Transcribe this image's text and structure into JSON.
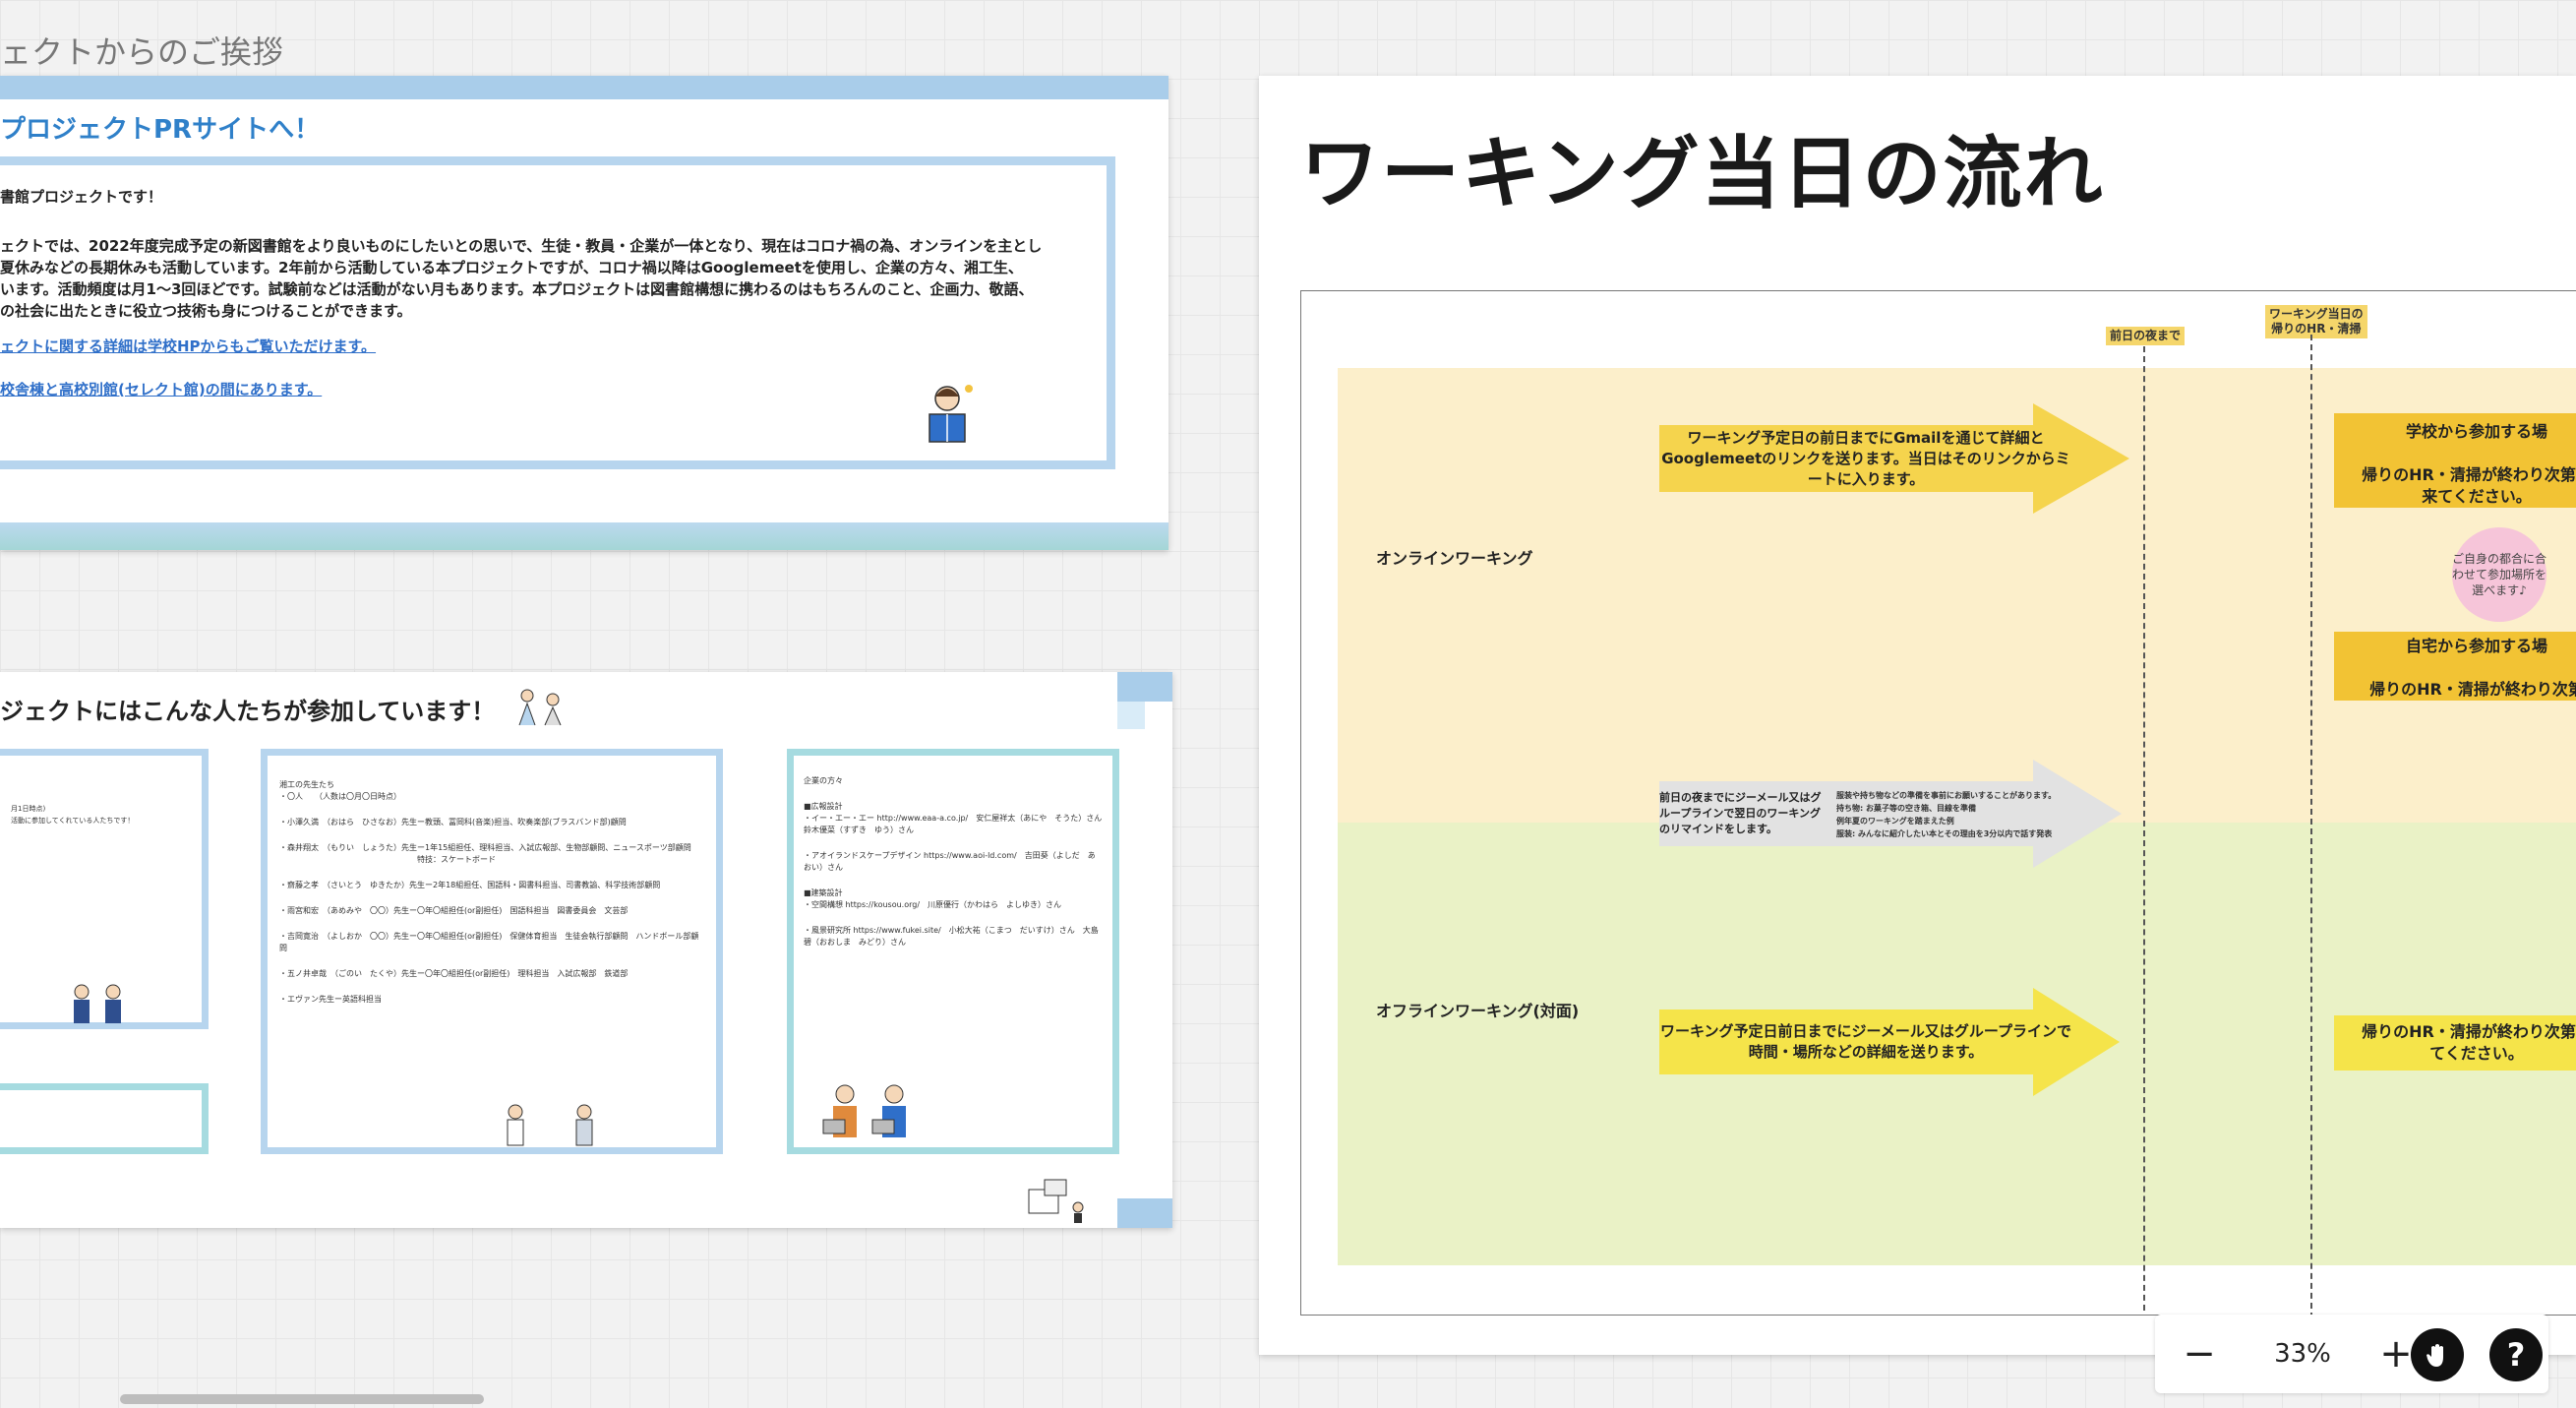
{
  "frame_label": "ェクトからのご挨拶",
  "slide1": {
    "title": "プロジェクトPRサイトへ！",
    "intro": "書館プロジェクトです！",
    "body_lines": [
      "ェクトでは、2022年度完成予定の新図書館をより良いものにしたいとの思いで、生徒・教員・企業が一体となり、現在はコロナ禍の為、オンラインを主とし",
      "夏休みなどの長期休みも活動しています。2年前から活動している本プロジェクトですが、コロナ禍以降はGooglemeetを使用し、企業の方々、湘工生、",
      "います。活動頻度は月1〜3回ほどです。試験前などは活動がない月もあります。本プロジェクトは図書館構想に携わるのはもちろんのこと、企画力、敬語、",
      "の社会に出たときに役立つ技術も身につけることができます。"
    ],
    "link1": "ェクトに関する詳細は学校HPからもご覧いただけます。",
    "link2": "校舎棟と高校別館(セレクト館)の間にあります。"
  },
  "slide2": {
    "title": "ジェクトにはこんな人たちが参加しています！",
    "card_a_lines": [
      "月1日時点)",
      "活動に参加してくれている人たちです！"
    ],
    "card_b_lines": [
      "湘工の先生たち",
      "・〇人　　（人数は〇月〇日時点）",
      "・小澤久満　（おはら　ひさなお）先生ー教頭、冨岡科(音楽)担当、吹奏楽部(ブラスバンド部)顧問",
      "・森井翔太　（もりい　しょうた）先生ー1年15組担任、理科担当、入試広報部、生物部顧問、ニュースポーツ部顧問",
      "特技：スケートボード",
      "・齋藤之孝　（さいとう　ゆきたか）先生ー2年18組担任、国語科・図書科担当、司書教諭、科学技術部顧問",
      "・雨宮和宏　（あめみや　〇〇）先生ー〇年〇組担任(or副担任)　国語科担当　図書委員会　文芸部",
      "・吉岡寛治　（よしおか　〇〇）先生ー〇年〇組担任(or副担任)　保健体育担当　生徒会執行部顧問　ハンドボール部顧問",
      "・五ノ井卓哉　（ごのい　たくや）先生ー〇年〇組担任(or副担任)　理科担当　入試広報部　鉄道部",
      "・エヴァン先生ー英語科担当"
    ],
    "card_c_lines": [
      "企業の方々",
      "■広報設計",
      "・イー・エー・エー http://www.eaa-a.co.jp/　安仁屋祥太（あにや　そうた）さん　鈴木優菜（すずき　ゆう）さん",
      "・アオイランドスケープデザイン https://www.aoi-ld.com/　吉田葵（よしだ　あおい）さん",
      "■建築設計",
      "・空間構想 https://kousou.org/　川原優行（かわはら　よしゆき）さん",
      "・風景研究所 https://www.fukei.site/　小松大祐（こまつ　だいすけ）さん　大島碧（おおしま　みどり）さん"
    ]
  },
  "board": {
    "title": "ワーキング当日の流れ",
    "timeline_tag_1": "前日の夜まで",
    "timeline_tag_2": "ワーキング当日の\n帰りのHR・清掃",
    "lane_online_label": "オンラインワーキング",
    "lane_offline_label": "オフラインワーキング(対面)",
    "arrow_online_text": "ワーキング予定日の前日までにGmailを通じて詳細とGooglemeetのリンクを送ります。当日はそのリンクからミートに入ります。",
    "arrow_reminder_left": "前日の夜までにジーメール又はグループラインで翌日のワーキングのリマインドをします。",
    "arrow_reminder_right_lines": [
      "服装や持ち物などの準備を事前にお願いすることがあります。",
      "持ち物: お菓子等の空き箱、目線を準備",
      "例年夏のワーキングを踏まえた例",
      "服装: みんなに紹介したい本とその理由を3分以内で話す発表"
    ],
    "arrow_offline_text": "ワーキング予定日前日までにジーメール又はグループラインで時間・場所などの詳細を送ります。",
    "school_box": "学校から参加する場\n\n帰りのHR・清掃が終わり次第指\n来てください。",
    "circle_note": "ご自身の都合に合わせて参加場所を選べます♪",
    "home_box": "自宅から参加する場\n\n帰りのHR・清掃が終わり次第",
    "offline_box": "帰りのHR・清掃が終わり次第指\nてください。"
  },
  "toolbar": {
    "zoom_out": "−",
    "zoom_level": "33%",
    "zoom_in": "+",
    "help": "?"
  },
  "colors": {
    "accent_blue": "#2f80c9",
    "online_lane": "#fcefcb",
    "offline_lane": "#eaf2c6",
    "arrow_yellow": "#f5d44d",
    "arrow_gold": "#f2c334",
    "arrow_gray": "#e2e2e2"
  }
}
